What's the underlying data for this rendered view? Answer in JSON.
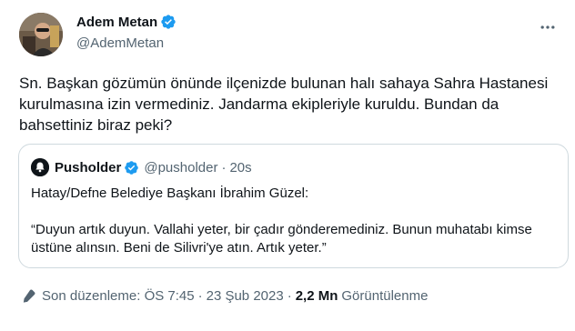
{
  "author": {
    "display_name": "Adem Metan",
    "handle": "@AdemMetan"
  },
  "tweet": {
    "text": "Sn. Başkan gözümün önünde ilçenizde bulunan halı sahaya Sahra Hastanesi kurulmasına izin vermediniz. Jandarma ekipleriyle kuruldu. Bundan da bahsettiniz biraz peki?"
  },
  "quote": {
    "display_name": "Pusholder",
    "handle": "@pusholder",
    "separator": "·",
    "time": "20s",
    "line1": "Hatay/Defne Belediye Başkanı İbrahim Güzel:",
    "line2": "“Duyun artık duyun. Vallahi yeter, bir çadır gönderemediniz. Bunun muhatabı kimse üstüne alınsın. Beni de Silivri'ye atın. Artık yeter.”"
  },
  "meta": {
    "edited_label": "Son düzenleme: ÖS 7:45",
    "separator": "·",
    "date": "23 Şub 2023",
    "views_count": "2,2 Mn",
    "views_label": "Görüntülenme"
  },
  "colors": {
    "verified": "#1d9bf0",
    "secondary_text": "#536471",
    "border": "#cfd9de"
  }
}
